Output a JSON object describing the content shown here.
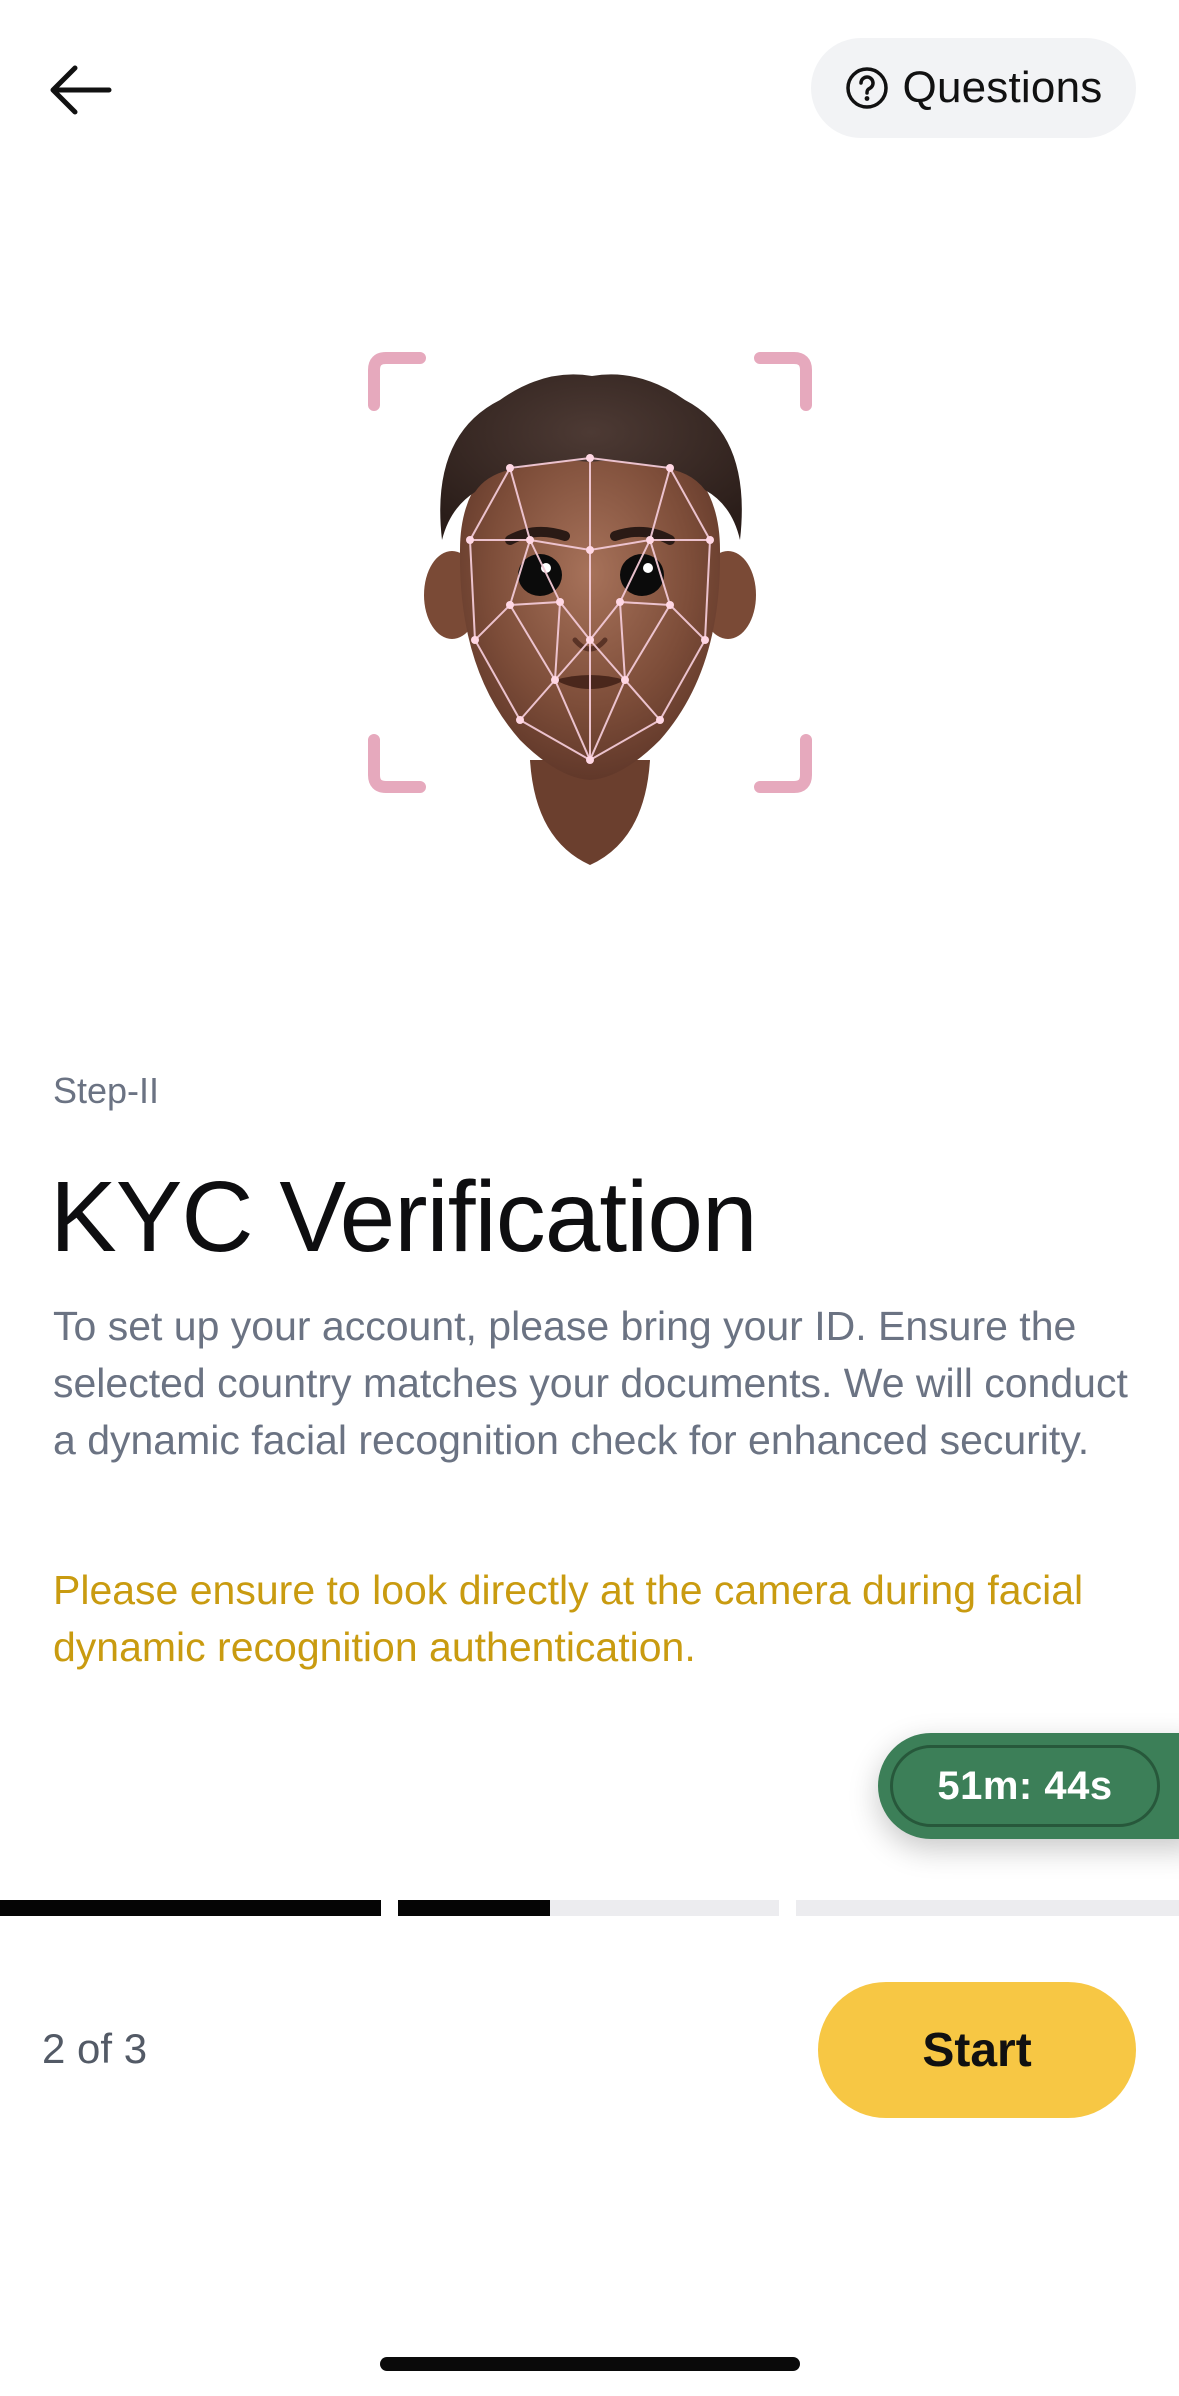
{
  "header": {
    "back_icon": "arrow-left-icon",
    "questions_icon": "question-circle-icon",
    "questions_label": "Questions"
  },
  "content": {
    "step_label": "Step-II",
    "title": "KYC Verification",
    "description": "To set up your account, please bring your ID. Ensure the selected country matches your documents. We will conduct a dynamic facial recognition check for enhanced security.",
    "warning": "Please ensure to look directly at the camera during facial dynamic recognition authentication."
  },
  "timer": {
    "value": "51m: 44s"
  },
  "progress": {
    "segments": [
      1,
      0.4,
      0,
      0
    ]
  },
  "footer": {
    "counter": "2 of 3",
    "start_label": "Start"
  },
  "colors": {
    "accent_yellow": "#f7c744",
    "warning_text": "#c99b10",
    "timer_green": "#3c7f58",
    "muted_text": "#6b7383",
    "scan_bracket": "#e6a9bd"
  }
}
